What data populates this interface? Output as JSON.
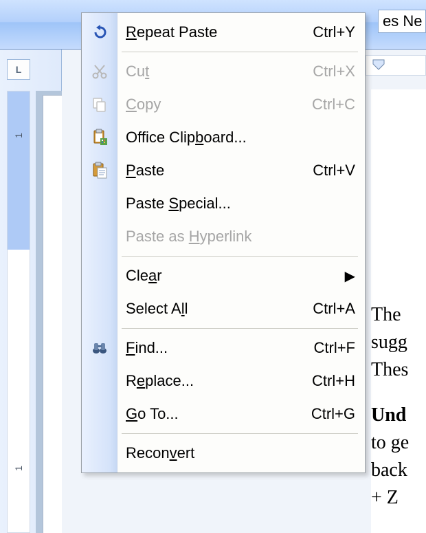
{
  "toolbar": {
    "font_preview": "es Ne"
  },
  "ruler": {
    "corner": "L",
    "vnum": "1",
    "vnum2": "1"
  },
  "menu": {
    "repeat": {
      "label": "Repeat Paste",
      "shortcut": "Ctrl+Y"
    },
    "cut": {
      "label": "Cut",
      "shortcut": "Ctrl+X"
    },
    "copy": {
      "label": "Copy",
      "shortcut": "Ctrl+C"
    },
    "clipboard": {
      "label": "Office Clipboard..."
    },
    "paste": {
      "label": "Paste",
      "shortcut": "Ctrl+V"
    },
    "pastespecial": {
      "label": "Paste Special..."
    },
    "pastehyper": {
      "label": "Paste as Hyperlink"
    },
    "clear": {
      "label": "Clear"
    },
    "selectall": {
      "label": "Select All",
      "shortcut": "Ctrl+A"
    },
    "find": {
      "label": "Find...",
      "shortcut": "Ctrl+F"
    },
    "replace": {
      "label": "Replace...",
      "shortcut": "Ctrl+H"
    },
    "goto": {
      "label": "Go To...",
      "shortcut": "Ctrl+G"
    },
    "reconvert": {
      "label": "Reconvert"
    }
  },
  "document": {
    "line1": "The ",
    "line2": "sugg",
    "line3": "Thes",
    "line4": "Und",
    "line5": "to ge",
    "line6": "back",
    "line7": "+ Z"
  }
}
